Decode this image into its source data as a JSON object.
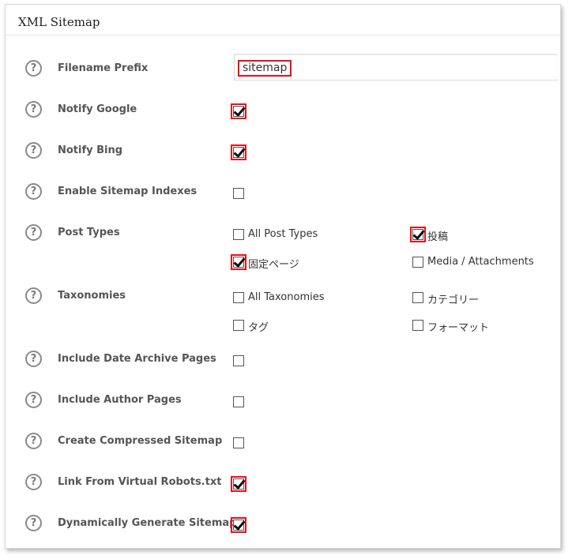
{
  "panel": {
    "title": "XML Sitemap"
  },
  "help_icon": {
    "glyph": "?"
  },
  "filename_prefix": {
    "label": "Filename Prefix",
    "value": "sitemap"
  },
  "notify_google": {
    "label": "Notify Google",
    "checked": true
  },
  "notify_bing": {
    "label": "Notify Bing",
    "checked": true
  },
  "enable_indexes": {
    "label": "Enable Sitemap Indexes",
    "checked": false
  },
  "post_types": {
    "label": "Post Types",
    "options": [
      {
        "label": "All Post Types",
        "checked": false
      },
      {
        "label": "投稿",
        "checked": true
      },
      {
        "label": "固定ページ",
        "checked": true
      },
      {
        "label": "Media / Attachments",
        "checked": false
      }
    ]
  },
  "taxonomies": {
    "label": "Taxonomies",
    "options": [
      {
        "label": "All Taxonomies",
        "checked": false
      },
      {
        "label": "カテゴリー",
        "checked": false
      },
      {
        "label": "タグ",
        "checked": false
      },
      {
        "label": "フォーマット",
        "checked": false
      }
    ]
  },
  "date_archive": {
    "label": "Include Date Archive Pages",
    "checked": false
  },
  "author_pages": {
    "label": "Include Author Pages",
    "checked": false
  },
  "compressed": {
    "label": "Create Compressed Sitemap",
    "checked": false
  },
  "robots_link": {
    "label": "Link From Virtual Robots.txt",
    "checked": true
  },
  "dynamic": {
    "label": "Dynamically Generate Sitemap",
    "checked": true
  },
  "colors": {
    "highlight": "#e8101c",
    "label_text": "#555555",
    "help_icon": "#8a8a8a"
  }
}
